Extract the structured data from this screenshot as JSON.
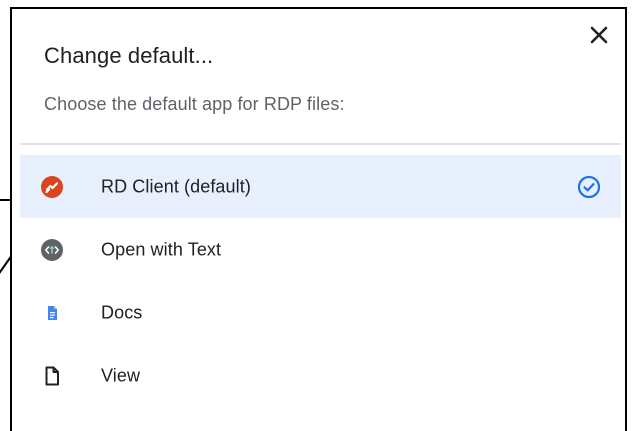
{
  "dialog": {
    "title": "Change default...",
    "subtitle": "Choose the default app for RDP files:",
    "close_icon": "close-icon"
  },
  "apps": [
    {
      "label": "RD Client (default)",
      "icon": "rd-client-icon",
      "selected": true
    },
    {
      "label": "Open with Text",
      "icon": "text-app-icon",
      "selected": false
    },
    {
      "label": "Docs",
      "icon": "docs-icon",
      "selected": false
    },
    {
      "label": "View",
      "icon": "file-icon",
      "selected": false
    }
  ],
  "colors": {
    "selected_row_bg": "#e8f0fe",
    "check_accent": "#1a73e8",
    "rd_client_red": "#d9451f",
    "docs_blue": "#4285f4",
    "text_app_gray": "#5f6368"
  }
}
